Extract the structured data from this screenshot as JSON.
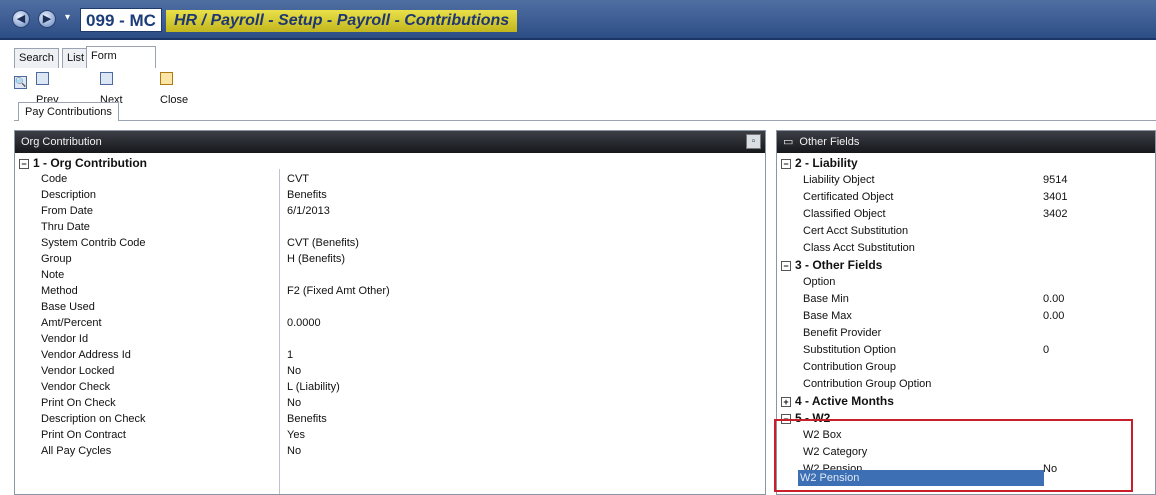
{
  "titlebar": {
    "module_code": "099 - MC",
    "breadcrumb": "HR / Payroll - Setup - Payroll - Contributions",
    "back_glyph": "◀",
    "forward_glyph": "▶",
    "dropdown_glyph": "▾"
  },
  "tabs": [
    "Search",
    "List",
    "Form"
  ],
  "toolbar": {
    "find_glyph": "🔍",
    "prev": "Prev",
    "next": "Next",
    "close": "Close"
  },
  "subtab": "Pay Contributions",
  "left_panel": {
    "title": "Org Contribution",
    "collapse_glyph": "▫",
    "group": "1 - Org Contribution",
    "group_toggle": "−",
    "rows": [
      {
        "label": "Code",
        "value": "CVT"
      },
      {
        "label": "Description",
        "value": "Benefits"
      },
      {
        "label": "From Date",
        "value": "6/1/2013"
      },
      {
        "label": "Thru Date",
        "value": ""
      },
      {
        "label": "System Contrib Code",
        "value": "CVT (Benefits)"
      },
      {
        "label": "Group",
        "value": "H (Benefits)"
      },
      {
        "label": "Note",
        "value": ""
      },
      {
        "label": "Method",
        "value": "F2 (Fixed Amt Other)"
      },
      {
        "label": "Base Used",
        "value": ""
      },
      {
        "label": "Amt/Percent",
        "value": "0.0000"
      },
      {
        "label": "Vendor Id",
        "value": ""
      },
      {
        "label": "Vendor Address Id",
        "value": "1"
      },
      {
        "label": "Vendor Locked",
        "value": "No"
      },
      {
        "label": "Vendor Check",
        "value": "L (Liability)"
      },
      {
        "label": "Print On Check",
        "value": "No"
      },
      {
        "label": "Description on Check",
        "value": "Benefits"
      },
      {
        "label": "Print On Contract",
        "value": "Yes"
      },
      {
        "label": "All Pay Cycles",
        "value": "No"
      }
    ]
  },
  "right_panel": {
    "title": "Other Fields",
    "title_glyph": "▭",
    "groups": [
      {
        "label": "2 - Liability",
        "toggle": "−",
        "rows": [
          {
            "label": "Liability Object",
            "value": "9514"
          },
          {
            "label": "Certificated Object",
            "value": "3401"
          },
          {
            "label": "Classified Object",
            "value": "3402"
          },
          {
            "label": "Cert Acct Substitution",
            "value": ""
          },
          {
            "label": "Class Acct Substitution",
            "value": ""
          }
        ]
      },
      {
        "label": "3 - Other Fields",
        "toggle": "−",
        "rows": [
          {
            "label": "Option",
            "value": ""
          },
          {
            "label": "Base Min",
            "value": "0.00"
          },
          {
            "label": "Base Max",
            "value": "0.00"
          },
          {
            "label": "Benefit Provider",
            "value": ""
          },
          {
            "label": "Substitution Option",
            "value": "0"
          },
          {
            "label": "Contribution Group",
            "value": ""
          },
          {
            "label": "Contribution Group Option",
            "value": ""
          }
        ]
      },
      {
        "label": "4 - Active Months",
        "toggle": "+",
        "rows": []
      },
      {
        "label": "5 - W2",
        "toggle": "−",
        "rows": [
          {
            "label": "W2 Box",
            "value": ""
          },
          {
            "label": "W2 Category",
            "value": ""
          },
          {
            "label": "W2 Pension",
            "value": "No"
          }
        ]
      }
    ]
  },
  "colors": {
    "title_bar": "#2d4d86",
    "breadcrumb_bg": "#d9cf2f",
    "highlight": "#c8202a",
    "selected_row": "#3d6fb4"
  }
}
